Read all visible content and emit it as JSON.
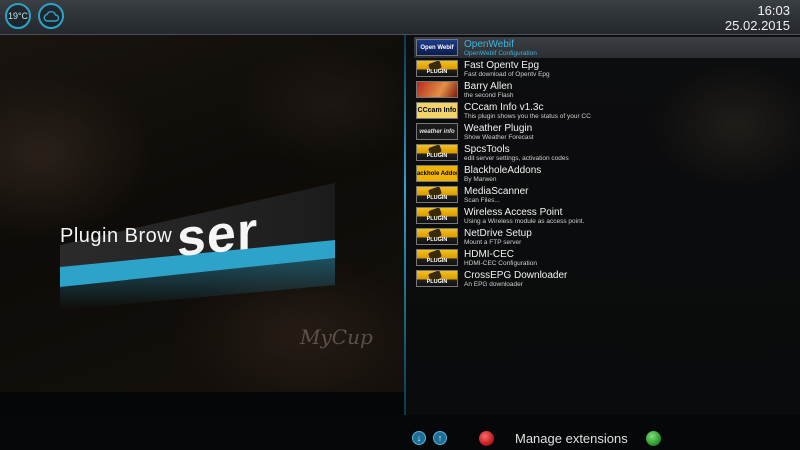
{
  "topbar": {
    "temperature": "19°C",
    "weather_icon": "cloud-icon",
    "time": "16:03",
    "date": "25.02.2015"
  },
  "art": {
    "title_small": "Plugin Browser",
    "title_part1": "Plugin Brow",
    "title_part2": "ser",
    "mug_text": "MyCup",
    "accent_color": "#2ea3c9"
  },
  "plugins": [
    {
      "name": "OpenWebif",
      "desc": "OpenWebif Configuration",
      "thumb": "webif",
      "thumb_text": "Open Webif",
      "selected": true
    },
    {
      "name": "Fast Opentv Epg",
      "desc": "Fast download of Opentv Epg",
      "thumb": "plugin",
      "thumb_text": "PLUGIN"
    },
    {
      "name": "Barry Allen",
      "desc": "the second Flash",
      "thumb": "person",
      "thumb_text": ""
    },
    {
      "name": "CCcam Info v1.3c",
      "desc": "This plugin shows you the status of your CC",
      "thumb": "cccam",
      "thumb_text": "CCcam Info"
    },
    {
      "name": "Weather Plugin",
      "desc": "Show Weather Forecast",
      "thumb": "weather",
      "thumb_text": "weather info"
    },
    {
      "name": "SpcsTools",
      "desc": "edit server settings, activation codes",
      "thumb": "plugin",
      "thumb_text": "PLUGIN"
    },
    {
      "name": "BlackholeAddons",
      "desc": "By Marwen",
      "thumb": "blackhole",
      "thumb_text": "Blackhole Addons"
    },
    {
      "name": "MediaScanner",
      "desc": "Scan Files...",
      "thumb": "plugin",
      "thumb_text": "PLUGIN"
    },
    {
      "name": "Wireless Access Point",
      "desc": "Using a Wireless module as access point.",
      "thumb": "plugin",
      "thumb_text": "PLUGIN"
    },
    {
      "name": "NetDrive Setup",
      "desc": "Mount a FTP server",
      "thumb": "plugin",
      "thumb_text": "PLUGIN"
    },
    {
      "name": "HDMI-CEC",
      "desc": "HDMI-CEC Configuration",
      "thumb": "plugin",
      "thumb_text": "PLUGIN"
    },
    {
      "name": "CrossEPG Downloader",
      "desc": "An EPG downloader",
      "thumb": "plugin",
      "thumb_text": "PLUGIN"
    }
  ],
  "bottom": {
    "down_icon": "arrow-down-icon",
    "up_icon": "arrow-up-icon",
    "red_label": "",
    "manage_label": "Manage extensions",
    "green_label": ""
  }
}
